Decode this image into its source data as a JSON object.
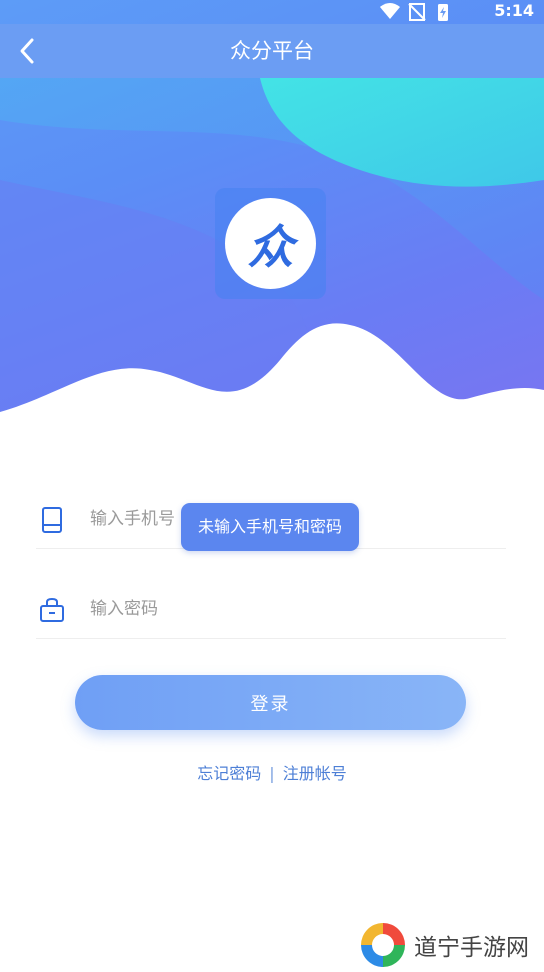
{
  "status_bar": {
    "time": "5:14"
  },
  "navbar": {
    "title": "众分平台"
  },
  "logo": {
    "char": "众"
  },
  "form": {
    "phone_placeholder": "输入手机号",
    "password_placeholder": "输入密码"
  },
  "toast": {
    "text": "未输入手机号和密码"
  },
  "login_button": {
    "label": "登录"
  },
  "links": {
    "forgot": "忘记密码",
    "separator": "|",
    "register": "注册帐号"
  },
  "watermark": {
    "text": "道宁手游网"
  },
  "colors": {
    "accent": "#6b9df3",
    "toast": "#5b86ef",
    "link": "#4d7fd6"
  }
}
